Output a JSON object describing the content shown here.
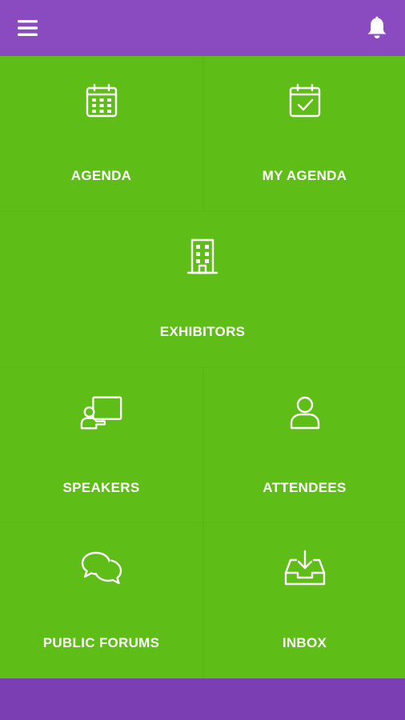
{
  "colors": {
    "topbar": "#8a4bc1",
    "tile_background": "#5ebe17",
    "grid_divider": "#5ab914",
    "bottombar": "#7b3fb3",
    "icon_and_text": "#ffffff"
  },
  "header": {
    "menu_icon": "hamburger-menu-icon",
    "notification_icon": "bell-icon"
  },
  "tiles": [
    {
      "label": "AGENDA",
      "icon": "calendar-icon"
    },
    {
      "label": "MY AGENDA",
      "icon": "calendar-check-icon"
    },
    {
      "label": "EXHIBITORS",
      "icon": "building-icon"
    },
    {
      "label": "SPEAKERS",
      "icon": "presenter-board-icon"
    },
    {
      "label": "ATTENDEES",
      "icon": "person-icon"
    },
    {
      "label": "PUBLIC FORUMS",
      "icon": "chat-bubbles-icon"
    },
    {
      "label": "INBOX",
      "icon": "inbox-download-icon"
    }
  ]
}
